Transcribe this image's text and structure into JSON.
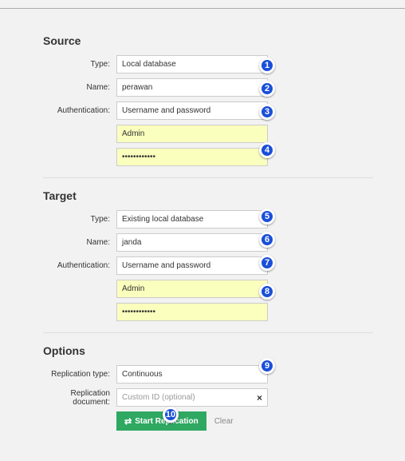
{
  "sections": {
    "source": {
      "title": "Source",
      "type_label": "Type:",
      "type_value": "Local database",
      "name_label": "Name:",
      "name_value": "perawan",
      "auth_label": "Authentication:",
      "auth_value": "Username and password",
      "username": "Admin",
      "password": "••••••••••••"
    },
    "target": {
      "title": "Target",
      "type_label": "Type:",
      "type_value": "Existing local database",
      "name_label": "Name:",
      "name_value": "janda",
      "auth_label": "Authentication:",
      "auth_value": "Username and password",
      "username": "Admin",
      "password": "••••••••••••"
    },
    "options": {
      "title": "Options",
      "rep_type_label": "Replication type:",
      "rep_type_value": "Continuous",
      "rep_doc_label": "Replication document:",
      "rep_doc_placeholder": "Custom ID (optional)",
      "clear_x": "×"
    }
  },
  "actions": {
    "start_label": "Start Replication",
    "clear_label": "Clear"
  },
  "callouts": [
    "1",
    "2",
    "3",
    "4",
    "5",
    "6",
    "7",
    "8",
    "9",
    "10"
  ]
}
